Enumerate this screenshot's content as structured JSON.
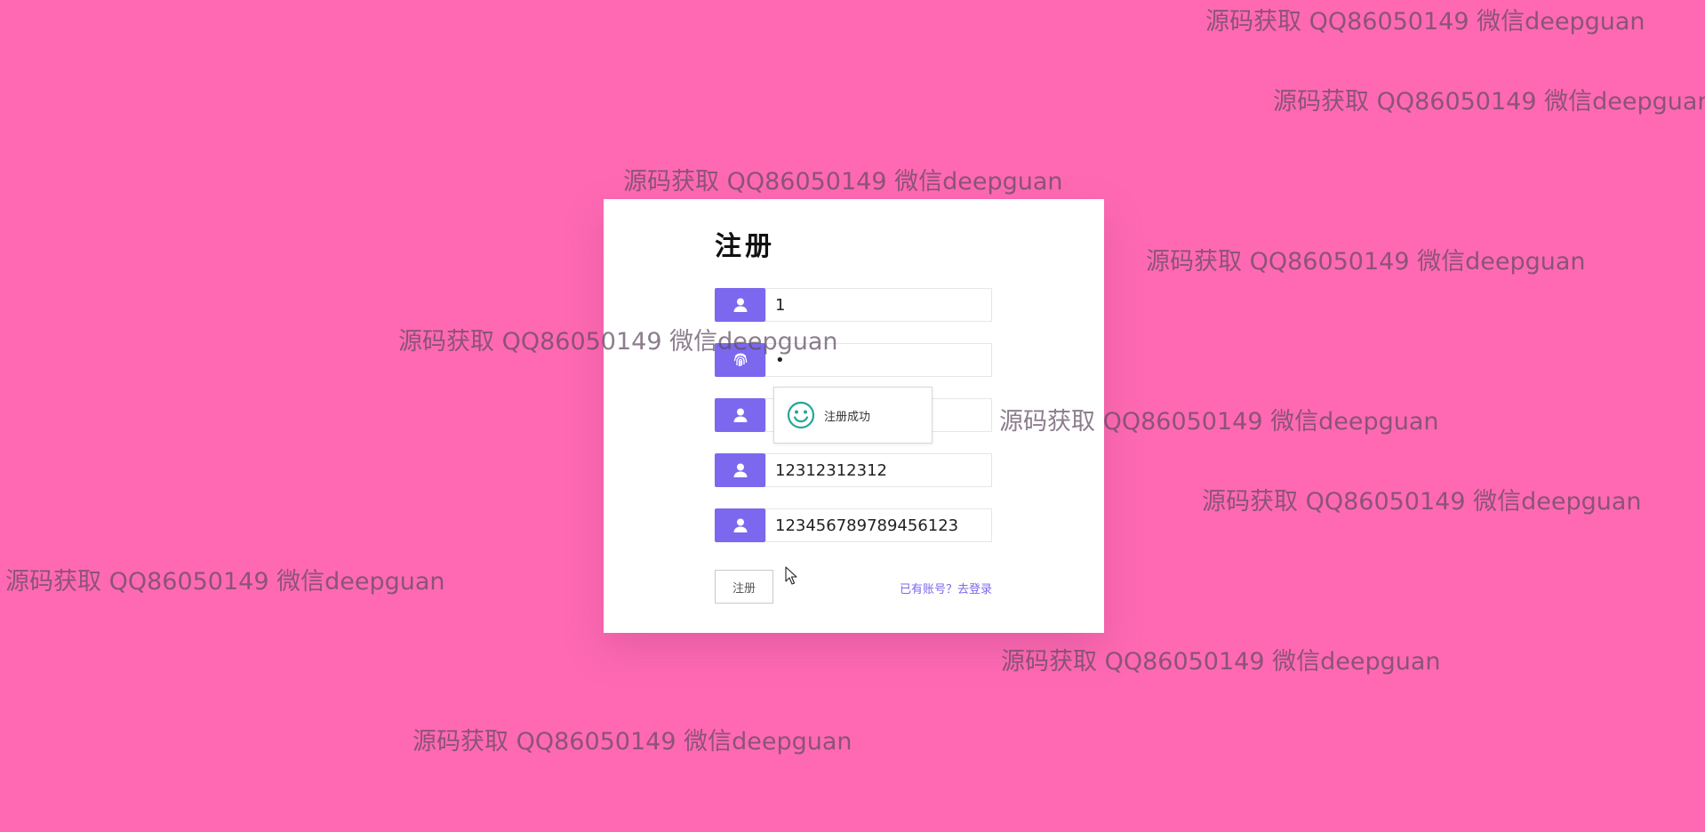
{
  "form": {
    "title": "注册",
    "fields": [
      {
        "icon": "user-icon",
        "value": "1"
      },
      {
        "icon": "fingerprint-icon",
        "value": "•"
      },
      {
        "icon": "user-icon",
        "value": ""
      },
      {
        "icon": "user-icon",
        "value": "12312312312"
      },
      {
        "icon": "user-icon",
        "value": "123456789789456123"
      }
    ],
    "submit_label": "注册",
    "login_link": "已有账号？去登录"
  },
  "toast": {
    "icon": "smile-icon",
    "message": "注册成功",
    "color": "#26a69a"
  },
  "watermark_text": "源码获取 QQ86050149 微信deepguan",
  "colors": {
    "background": "#ff69b4",
    "accent": "#7b68ee",
    "card": "#ffffff"
  }
}
